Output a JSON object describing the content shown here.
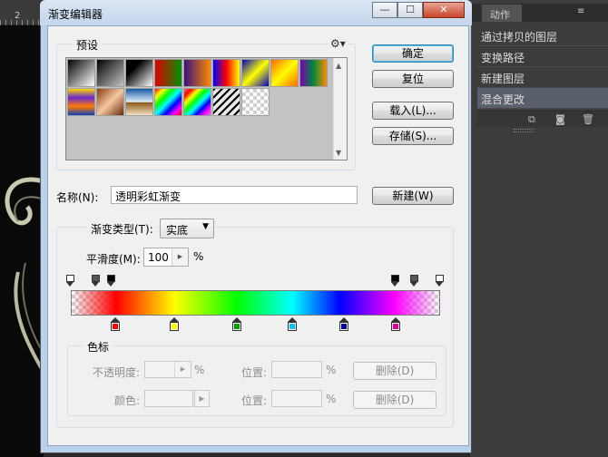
{
  "background": {
    "ruler_number": "2",
    "panel": {
      "tab_label": "动作",
      "menu_icon": "menu-icon",
      "history_items": [
        {
          "label": "通过拷贝的图层"
        },
        {
          "label": "变换路径"
        },
        {
          "label": "新建图层"
        },
        {
          "label": "混合更改"
        }
      ],
      "active_item": "混合更改",
      "footer_icons": [
        "new-document-icon",
        "camera-icon",
        "trash-icon"
      ]
    }
  },
  "window": {
    "title": "渐变编辑器",
    "controls": {
      "minimize": "—",
      "maximize": "☐",
      "close": "✕"
    }
  },
  "presets": {
    "legend": "预设",
    "gear_icon": "gear-icon",
    "swatches": [
      {
        "label": "foreground-to-background",
        "css": "linear-gradient(135deg,#000,#fff)"
      },
      {
        "label": "foreground-to-transparent",
        "css": "linear-gradient(135deg,#000,rgba(0,0,0,0))"
      },
      {
        "label": "black-white",
        "css": "linear-gradient(135deg,#000 30%,#fff)"
      },
      {
        "label": "red-green",
        "css": "linear-gradient(90deg,#e00000,#009000)"
      },
      {
        "label": "violet-orange",
        "css": "linear-gradient(90deg,#3b0f80,#ff8a00)"
      },
      {
        "label": "blue-red-yellow",
        "css": "linear-gradient(90deg,#0000ff,#ff0000,#ffff00)"
      },
      {
        "label": "blue-yellow-blue",
        "css": "linear-gradient(135deg,#0000c0,#ffff00,#0000c0)"
      },
      {
        "label": "orange-yellow-orange",
        "css": "linear-gradient(135deg,#ff6a00,#ffff00,#ff6a00)"
      },
      {
        "label": "violet-green-orange",
        "css": "linear-gradient(90deg,#7a00b0,#008a3a,#ff8a00)"
      },
      {
        "label": "yellow-violet-orange-blue",
        "css": "linear-gradient(180deg,#ffd800,#6a2ad0,#ff7a00,#1040c0)"
      },
      {
        "label": "copper",
        "css": "linear-gradient(135deg,#8a3a10,#f5c8a0,#6a2a08)"
      },
      {
        "label": "chrome",
        "css": "linear-gradient(180deg,#1a5aa0,#e0f0ff 50%,#8a5a1a 52%,#f0e0c0)"
      },
      {
        "label": "spectrum",
        "css": "linear-gradient(135deg,#ff0000,#ffff00,#00ff00,#00ffff,#0000ff,#ff00ff,#ff0000)"
      },
      {
        "label": "transparent-rainbow",
        "css": "linear-gradient(135deg,rgba(255,0,0,0.4),#ff0000,#ffff00,#00ff00,#00ffff,#0000ff,#ff00ff,rgba(255,0,255,0.4))"
      },
      {
        "label": "transparent-stripes",
        "css": "repeating-linear-gradient(135deg,#000 0 2px,rgba(255,255,255,0.6) 2px 6px)"
      },
      {
        "label": "transparent-checker",
        "css": "repeating-conic-gradient(#d0d0d0 0 25%,#ffffff 0 50%) 0 0 / 8px 8px"
      }
    ],
    "scroll_up": "▲",
    "scroll_down": "▼"
  },
  "buttons": {
    "ok": "确定",
    "reset": "复位",
    "load": "载入(L)...",
    "save": "存储(S)...",
    "new": "新建(W)"
  },
  "name_field": {
    "label": "名称(N):",
    "value": "透明彩虹渐变"
  },
  "gradient": {
    "type_label": "渐变类型(T):",
    "type_value": "实底",
    "smoothness_label": "平滑度(M):",
    "smoothness_value": "100",
    "smoothness_unit": "%",
    "bar_colors": [
      "#ff0000",
      "#ffff00",
      "#00ff00",
      "#00ffff",
      "#0000ff",
      "#ff00ff"
    ],
    "opacity_stops": [
      {
        "location": 0,
        "color": "#ffffff"
      },
      {
        "location": 7,
        "color": "#555555"
      },
      {
        "location": 11,
        "color": "#000000"
      },
      {
        "location": 88,
        "color": "#000000"
      },
      {
        "location": 93,
        "color": "#555555"
      },
      {
        "location": 100,
        "color": "#ffffff"
      }
    ],
    "color_stops": [
      {
        "location": 12,
        "color": "#ff0000"
      },
      {
        "location": 28,
        "color": "#ffff00"
      },
      {
        "location": 45,
        "color": "#00a000"
      },
      {
        "location": 60,
        "color": "#00c8ff"
      },
      {
        "location": 74,
        "color": "#0000a0"
      },
      {
        "location": 88,
        "color": "#e000a0"
      }
    ]
  },
  "stops_group": {
    "legend": "色标",
    "opacity_label": "不透明度:",
    "opacity_unit": "%",
    "color_label": "颜色:",
    "location_label": "位置:",
    "location_unit": "%",
    "delete_label": "删除(D)"
  }
}
